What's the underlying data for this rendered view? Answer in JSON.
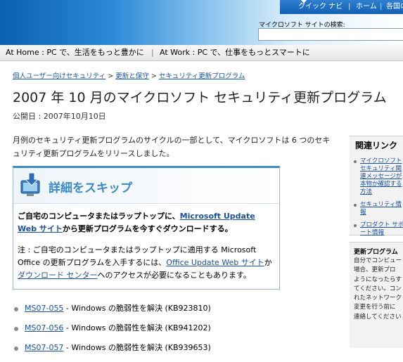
{
  "topnav": {
    "quick_navi": "クイック ナビ",
    "home": "ホーム",
    "each_country": "各国のサ"
  },
  "search": {
    "label": "マイクロソフト サイトの検索:",
    "value": ""
  },
  "tagline": {
    "home": "At Home : PC で、生活をもっと豊かに",
    "work": "At Work : PC で、仕事をもっとスマートに"
  },
  "breadcrumb": {
    "items": [
      "個人ユーザー向けセキュリティ",
      "更新と保守",
      "セキュリティ更新プログラム"
    ],
    "separator": ">"
  },
  "page": {
    "title": "2007 年 10 月のマイクロソフト セキュリティ更新プログラム",
    "published": "公開日 : 2007年10月10日",
    "intro": "月例のセキュリティ更新プログラムのサイクルの一部として、マイクロソフトは 6 つのセキュリティ更新プログラムをリリースしました。"
  },
  "skip_box": {
    "title": "詳細をスキップ",
    "main_before": "ご自宅のコンピュータまたはラップトップに、",
    "main_link": "Microsoft Update Web サイト",
    "main_after": "から更新プログラムを今すぐダウンロードする。",
    "note_before": "注 : ご自宅のコンピュータまたはラップトップに適用する Microsoft Office の更新プログラムを入手するには、",
    "note_link1": "Office Update Web サイト",
    "note_mid": "か",
    "note_link2": "ダウンロード センター",
    "note_after": "へのアクセスが必要になることもあります。"
  },
  "bulletins": [
    {
      "id": "MS07-055",
      "text": " - Windows の脆弱性を解決 (KB923810)"
    },
    {
      "id": "MS07-056",
      "text": " - Windows の脆弱性を解決 (KB941202)"
    },
    {
      "id": "MS07-057",
      "text": " - Windows の脆弱性を解決 (KB939653)"
    }
  ],
  "sidebar": {
    "related_title": "関連リンク",
    "related_links": [
      "マイクロソフト セキュリティ関連メッセージが本物か確認する方法",
      "セキュリティ情報",
      "プロダクト サポート情報"
    ],
    "box2_title": "更新プログラム",
    "box2_lines": "自分でコンピュー\n場合、更新プロ\nようになったらす\nてください。コン\nれたネットワーク\n変更を行う前に\n連絡してください"
  }
}
